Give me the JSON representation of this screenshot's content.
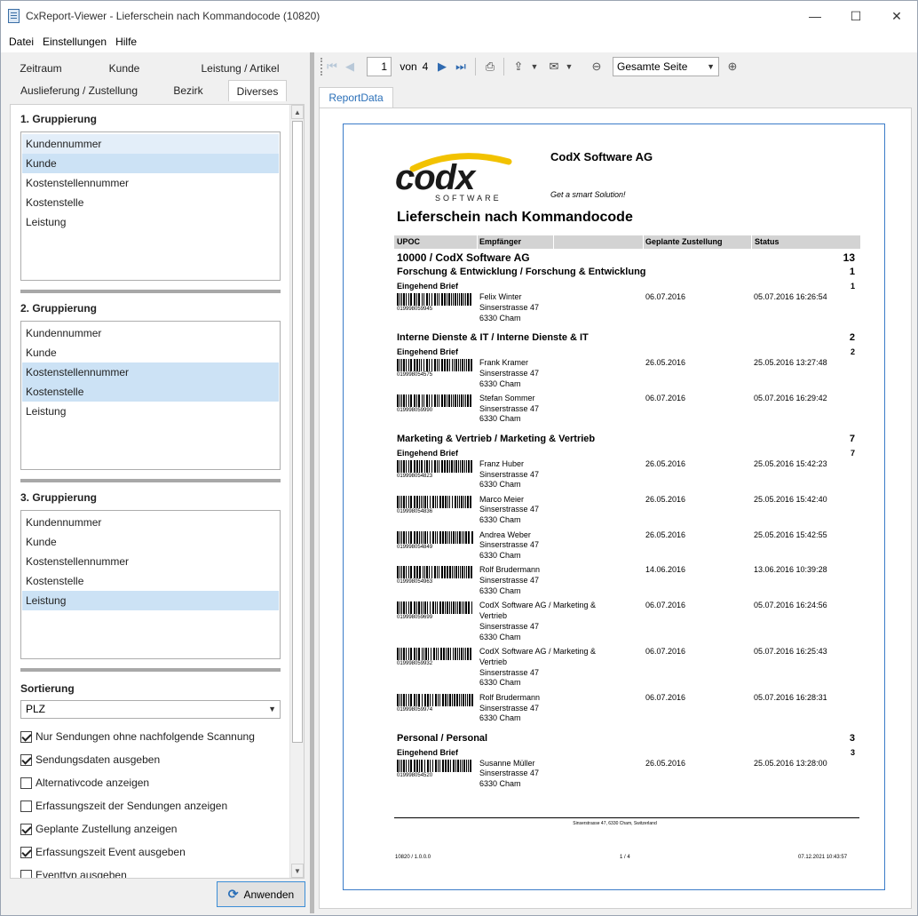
{
  "window": {
    "title": "CxReport-Viewer - Lieferschein nach Kommandocode (10820)",
    "minimize": "—",
    "maximize": "☐",
    "close": "✕"
  },
  "menu": [
    "Datei",
    "Einstellungen",
    "Hilfe"
  ],
  "tabs": {
    "row1": [
      "Zeitraum",
      "Kunde",
      "Leistung / Artikel"
    ],
    "row2": [
      "Auslieferung / Zustellung",
      "Bezirk",
      "Diverses"
    ],
    "active": "Diverses"
  },
  "groupings": [
    {
      "title": "1. Gruppierung",
      "items": [
        "Kundennummer",
        "Kunde",
        "Kostenstellennummer",
        "Kostenstelle",
        "Leistung"
      ]
    },
    {
      "title": "2. Gruppierung",
      "items": [
        "Kundennummer",
        "Kunde",
        "Kostenstellennummer",
        "Kostenstelle",
        "Leistung"
      ]
    },
    {
      "title": "3. Gruppierung",
      "items": [
        "Kundennummer",
        "Kunde",
        "Kostenstellennummer",
        "Kostenstelle",
        "Leistung"
      ]
    }
  ],
  "sort": {
    "label": "Sortierung",
    "value": "PLZ"
  },
  "options": [
    {
      "label": "Nur Sendungen ohne nachfolgende Scannung",
      "checked": true
    },
    {
      "label": "Sendungsdaten ausgeben",
      "checked": true
    },
    {
      "label": "Alternativcode anzeigen",
      "checked": false
    },
    {
      "label": "Erfassungszeit der Sendungen anzeigen",
      "checked": false
    },
    {
      "label": "Geplante Zustellung anzeigen",
      "checked": true
    },
    {
      "label": "Erfassungszeit Event ausgeben",
      "checked": true
    },
    {
      "label": "Eventtyp ausgeben",
      "checked": false
    }
  ],
  "apply_button": "Anwenden",
  "toolbar": {
    "page": "1",
    "of": "von",
    "total": "4",
    "zoom": "Gesamte Seite"
  },
  "report_tab": "ReportData",
  "report": {
    "company": "CodX Software AG",
    "slogan": "Get a smart Solution!",
    "logo_text": "codx",
    "logo_sub": "SOFTWARE",
    "title": "Lieferschein nach Kommandocode",
    "columns": [
      "UPOC",
      "Empfänger",
      "Geplante Zustellung",
      "Status"
    ],
    "customer": {
      "label": "10000 / CodX Software AG",
      "count": "13"
    },
    "sections": [
      {
        "name": "Forschung & Entwicklung / Forschung & Entwicklung",
        "count": "1",
        "sub": "Eingehend  Brief",
        "sub_count": "1",
        "rows": [
          {
            "code": "019998059945",
            "name": "Felix Winter",
            "street": "Sinserstrasse 47",
            "city": "6330 Cham",
            "planned": "06.07.2016",
            "status": "05.07.2016 16:26:54"
          }
        ]
      },
      {
        "name": "Interne Dienste & IT / Interne Dienste & IT",
        "count": "2",
        "sub": "Eingehend  Brief",
        "sub_count": "2",
        "rows": [
          {
            "code": "019998054575",
            "name": "Frank Kramer",
            "street": "Sinserstrasse 47",
            "city": "6330 Cham",
            "planned": "26.05.2016",
            "status": "25.05.2016 13:27:48"
          },
          {
            "code": "019998059990",
            "name": "Stefan Sommer",
            "street": "Sinserstrasse 47",
            "city": "6330 Cham",
            "planned": "06.07.2016",
            "status": "05.07.2016 16:29:42"
          }
        ]
      },
      {
        "name": "Marketing & Vertrieb / Marketing & Vertrieb",
        "count": "7",
        "sub": "Eingehend  Brief",
        "sub_count": "7",
        "rows": [
          {
            "code": "019998054823",
            "name": "Franz Huber",
            "street": "Sinserstrasse 47",
            "city": "6330 Cham",
            "planned": "26.05.2016",
            "status": "25.05.2016 15:42:23"
          },
          {
            "code": "019998054836",
            "name": "Marco Meier",
            "street": "Sinserstrasse 47",
            "city": "6330 Cham",
            "planned": "26.05.2016",
            "status": "25.05.2016 15:42:40"
          },
          {
            "code": "019998054849",
            "name": "Andrea Weber",
            "street": "Sinserstrasse 47",
            "city": "6330 Cham",
            "planned": "26.05.2016",
            "status": "25.05.2016 15:42:55"
          },
          {
            "code": "019998054963",
            "name": "Rolf Brudermann",
            "street": "Sinserstrasse 47",
            "city": "6330 Cham",
            "planned": "14.06.2016",
            "status": "13.06.2016 10:39:28"
          },
          {
            "code": "019998059699",
            "name": "CodX Software AG   / Marketing &",
            "name2": "Vertrieb",
            "street": "Sinserstrasse 47",
            "city": "6330 Cham",
            "planned": "06.07.2016",
            "status": "05.07.2016 16:24:56"
          },
          {
            "code": "019998059932",
            "name": "CodX Software AG   / Marketing &",
            "name2": "Vertrieb",
            "street": "Sinserstrasse 47",
            "city": "6330 Cham",
            "planned": "06.07.2016",
            "status": "05.07.2016 16:25:43"
          },
          {
            "code": "019998059974",
            "name": "Rolf Brudermann",
            "street": "Sinserstrasse 47",
            "city": "6330 Cham",
            "planned": "06.07.2016",
            "status": "05.07.2016 16:28:31"
          }
        ]
      },
      {
        "name": "Personal / Personal",
        "count": "3",
        "sub": "Eingehend  Brief",
        "sub_count": "3",
        "rows": [
          {
            "code": "019998054520",
            "name": "Susanne Müller",
            "street": "Sinserstrasse 47",
            "city": "6330 Cham",
            "planned": "26.05.2016",
            "status": "25.05.2016 13:28:00"
          }
        ]
      }
    ],
    "footer": {
      "address": "Sinserstrasse 47, 6330 Cham, Switzerland",
      "left": "10820 / 1.0.0.0",
      "mid": "1 / 4",
      "right": "07.12.2021 10:43:57"
    }
  }
}
